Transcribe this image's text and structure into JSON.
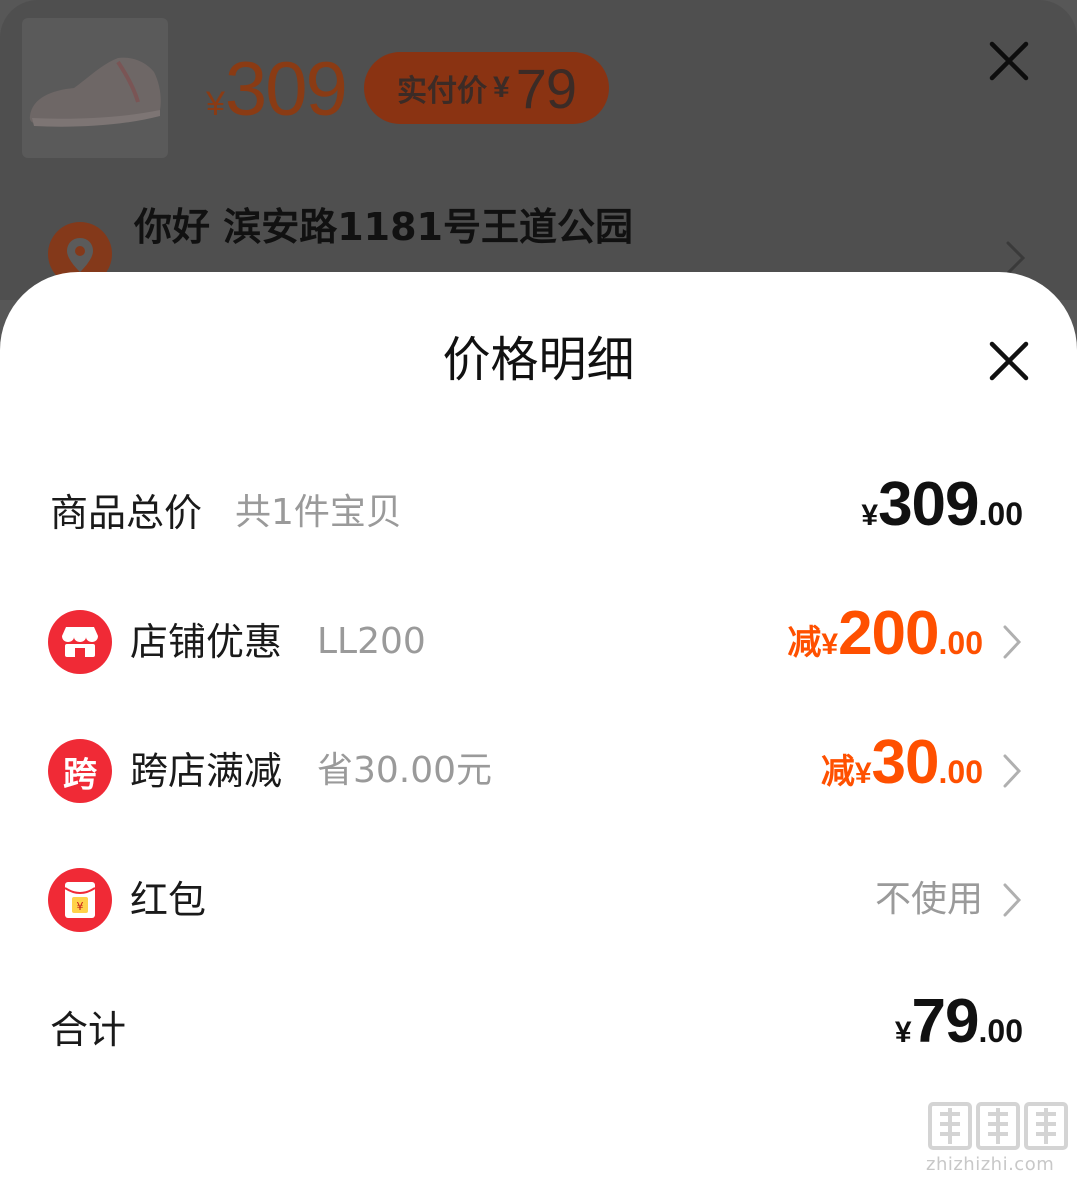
{
  "background": {
    "price_currency": "¥",
    "price": "309",
    "paid_label": "实付价",
    "paid_currency": "¥",
    "paid_amount": "79",
    "address": "你好 滨安路1181号王道公园"
  },
  "sheet": {
    "title": "价格明细",
    "rows": [
      {
        "label": "商品总价",
        "sub": "共1件宝贝",
        "currency": "¥",
        "int": "309",
        "dec": ".00"
      },
      {
        "icon": "store-icon",
        "label": "店铺优惠",
        "sub": "LL200",
        "prefix": "减",
        "currency": "¥",
        "int": "200",
        "dec": ".00"
      },
      {
        "icon": "cross-store-icon",
        "icon_char": "跨",
        "label": "跨店满减",
        "sub": "省30.00元",
        "prefix": "减",
        "currency": "¥",
        "int": "30",
        "dec": ".00"
      },
      {
        "icon": "red-packet-icon",
        "label": "红包",
        "value": "不使用"
      },
      {
        "label": "合计",
        "currency": "¥",
        "int": "79",
        "dec": ".00"
      }
    ]
  },
  "watermark": {
    "text": "zhizhizhi.com"
  },
  "colors": {
    "accent": "#ff5000",
    "icon_red": "#f02a36",
    "muted": "#9a9a9a"
  }
}
